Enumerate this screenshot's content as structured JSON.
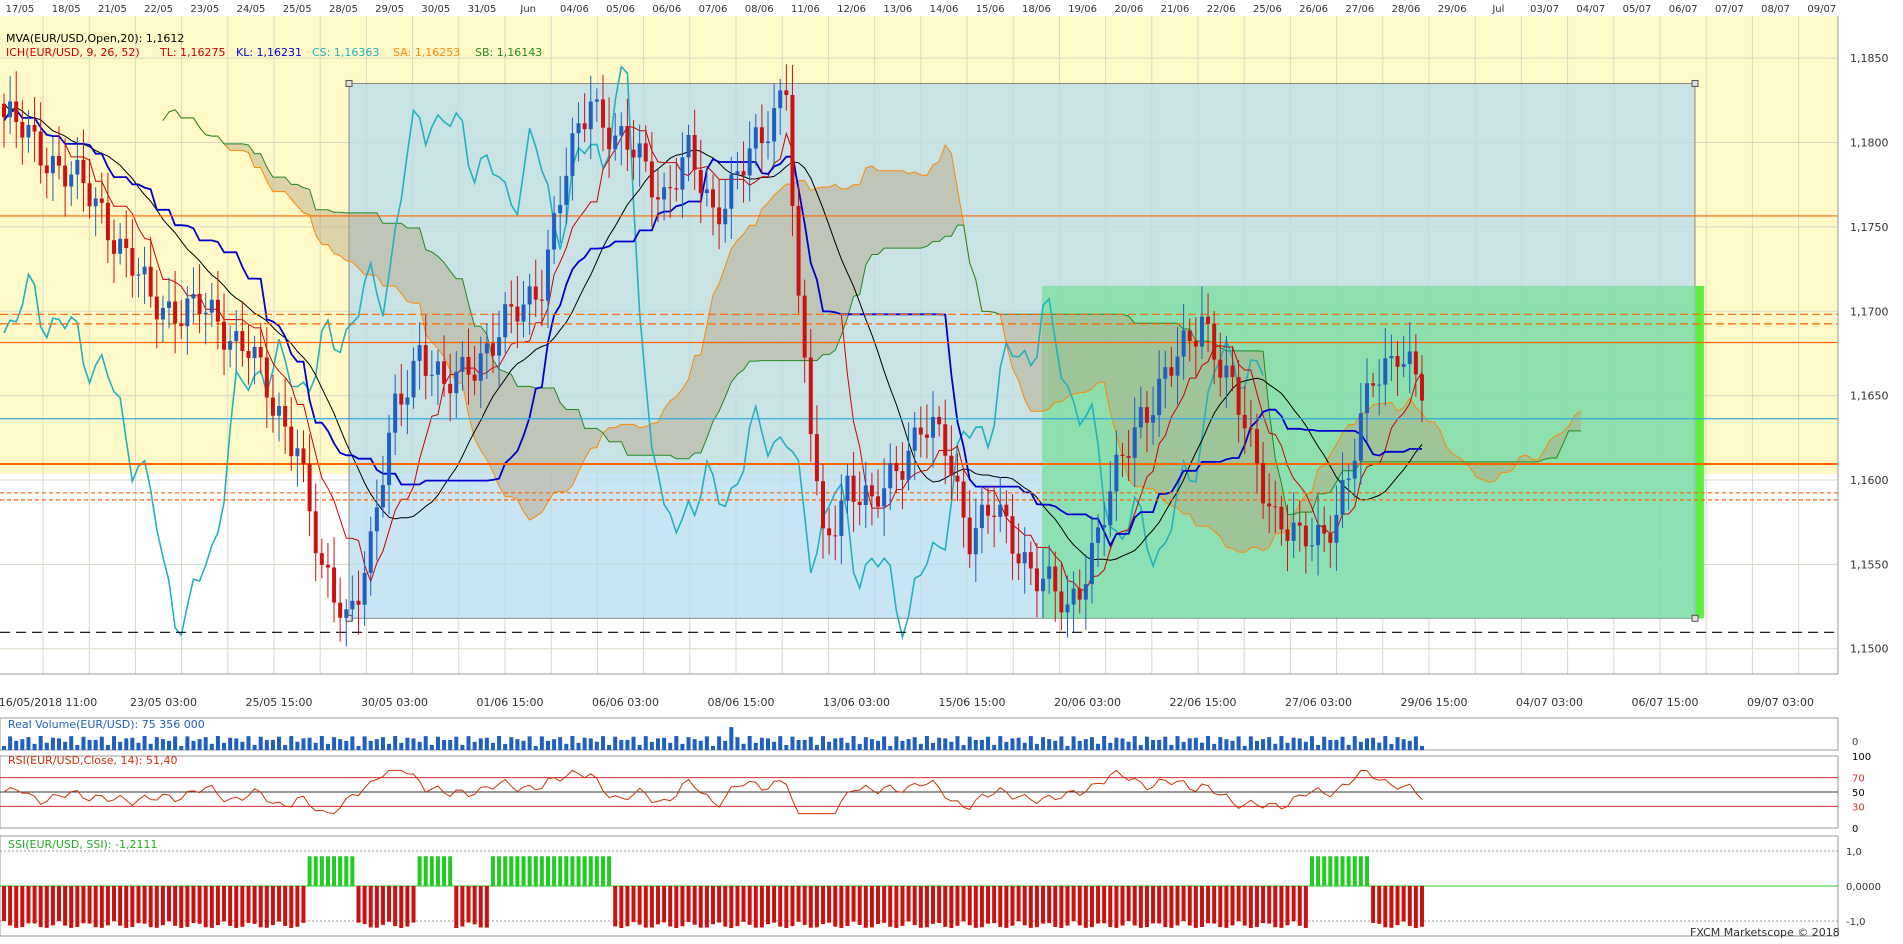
{
  "chart_data": {
    "type": "candlestick",
    "instrument": "EUR/USD",
    "footer_brand": "FXCM Marketscope © 2018",
    "top_dates": [
      "17/05",
      "18/05",
      "21/05",
      "22/05",
      "23/05",
      "24/05",
      "25/05",
      "28/05",
      "29/05",
      "30/05",
      "31/05",
      "Jun",
      "04/06",
      "05/06",
      "06/06",
      "07/06",
      "08/06",
      "11/06",
      "12/06",
      "13/06",
      "14/06",
      "15/06",
      "18/06",
      "19/06",
      "20/06",
      "21/06",
      "22/06",
      "25/06",
      "26/06",
      "27/06",
      "28/06",
      "29/06",
      "Jul",
      "03/07",
      "04/07",
      "05/07",
      "06/07",
      "07/07",
      "08/07",
      "09/07"
    ],
    "bottom_time_labels": [
      "16/05/2018 11:00",
      "23/05 03:00",
      "25/05 15:00",
      "30/05 03:00",
      "01/06 15:00",
      "06/06 03:00",
      "08/06 15:00",
      "13/06 03:00",
      "15/06 15:00",
      "20/06 03:00",
      "22/06 15:00",
      "27/06 03:00",
      "29/06 15:00",
      "04/07 03:00",
      "06/07 15:00",
      "09/07 03:00"
    ],
    "y_axis": {
      "min": 1.1485,
      "max": 1.1875,
      "ticks": [
        "1,1850",
        "1,1800",
        "1,1750",
        "1,1700",
        "1,1650",
        "1,1600",
        "1,1550",
        "1,1500"
      ]
    },
    "indicator_labels": {
      "mva": "MVA(EUR/USD,Open,20): 1,1612",
      "ich_prefix": "ICH(EUR/USD, 9, 26, 52)",
      "tl": "TL: 1,16275",
      "kl": "KL: 1,16231",
      "cs": "CS: 1,16363",
      "sa": "SA: 1,16253",
      "sb": "SB: 1,16143"
    },
    "price_tags": [
      {
        "label": "1,17565",
        "value": 1.17565,
        "color": "#ff6600"
      },
      {
        "label": "1,16982",
        "value": 1.16982,
        "color": "#ff6600"
      },
      {
        "label": "1,16925",
        "value": 1.16925,
        "color": "#ff6600"
      },
      {
        "label": "1,16815",
        "value": 1.16815,
        "color": "#ff6600"
      },
      {
        "label": "1,16363",
        "value": 1.16363,
        "color": "#33aadd"
      },
      {
        "label": "1,16095",
        "value": 1.16095,
        "color": "#ff6600"
      },
      {
        "label": "1,15924",
        "value": 1.15924,
        "color": "#ff6600"
      },
      {
        "label": "1,15882",
        "value": 1.15882,
        "color": "#ff6600"
      },
      {
        "label": "1,15097",
        "value": 1.15097,
        "color": "#000000"
      }
    ],
    "volume_panel": {
      "label": "Real Volume(EUR/USD): 75 356 000",
      "axis_zero": "0"
    },
    "rsi_panel": {
      "label": "RSI(EUR/USD,Close, 14): 51,40",
      "levels": [
        "100",
        "70",
        "50",
        "30",
        "0"
      ],
      "value": 51.4
    },
    "ssi_panel": {
      "label": "SSI(EUR/USD, SSI): -1,2111",
      "levels": [
        "1,0",
        "0,0000",
        "-1,0"
      ],
      "value": -1.2111
    },
    "series": [
      {
        "name": "Price (candles)",
        "color_up": "#1f5fbf",
        "color_down": "#cc1111"
      },
      {
        "name": "MVA",
        "color": "#000000"
      },
      {
        "name": "TL",
        "color": "#cc0000"
      },
      {
        "name": "KL",
        "color": "#0000cc"
      },
      {
        "name": "CS",
        "color": "#20b2c0"
      },
      {
        "name": "SA",
        "color": "#ff8800"
      },
      {
        "name": "SB",
        "color": "#228822"
      }
    ],
    "close_anchors": [
      [
        0,
        1.1815
      ],
      [
        8,
        1.179
      ],
      [
        16,
        1.176
      ],
      [
        24,
        1.1705
      ],
      [
        32,
        1.17
      ],
      [
        40,
        1.168
      ],
      [
        44,
        1.164
      ],
      [
        48,
        1.1625
      ],
      [
        52,
        1.154
      ],
      [
        56,
        1.152
      ],
      [
        60,
        1.156
      ],
      [
        64,
        1.164
      ],
      [
        68,
        1.168
      ],
      [
        72,
        1.165
      ],
      [
        76,
        1.167
      ],
      [
        80,
        1.168
      ],
      [
        84,
        1.17
      ],
      [
        88,
        1.172
      ],
      [
        92,
        1.178
      ],
      [
        96,
        1.183
      ],
      [
        100,
        1.18
      ],
      [
        104,
        1.179
      ],
      [
        108,
        1.177
      ],
      [
        112,
        1.179
      ],
      [
        116,
        1.176
      ],
      [
        120,
        1.178
      ],
      [
        124,
        1.18
      ],
      [
        128,
        1.184
      ],
      [
        130,
        1.17
      ],
      [
        134,
        1.156
      ],
      [
        138,
        1.16
      ],
      [
        142,
        1.158
      ],
      [
        146,
        1.161
      ],
      [
        150,
        1.163
      ],
      [
        154,
        1.162
      ],
      [
        158,
        1.157
      ],
      [
        162,
        1.158
      ],
      [
        166,
        1.156
      ],
      [
        170,
        1.154
      ],
      [
        174,
        1.152
      ],
      [
        178,
        1.156
      ],
      [
        182,
        1.16
      ],
      [
        186,
        1.164
      ],
      [
        190,
        1.166
      ],
      [
        194,
        1.168
      ],
      [
        196,
        1.17
      ],
      [
        200,
        1.166
      ],
      [
        204,
        1.162
      ],
      [
        208,
        1.158
      ],
      [
        212,
        1.156
      ],
      [
        216,
        1.157
      ],
      [
        220,
        1.16
      ],
      [
        224,
        1.166
      ],
      [
        228,
        1.168
      ],
      [
        232,
        1.165
      ]
    ]
  }
}
